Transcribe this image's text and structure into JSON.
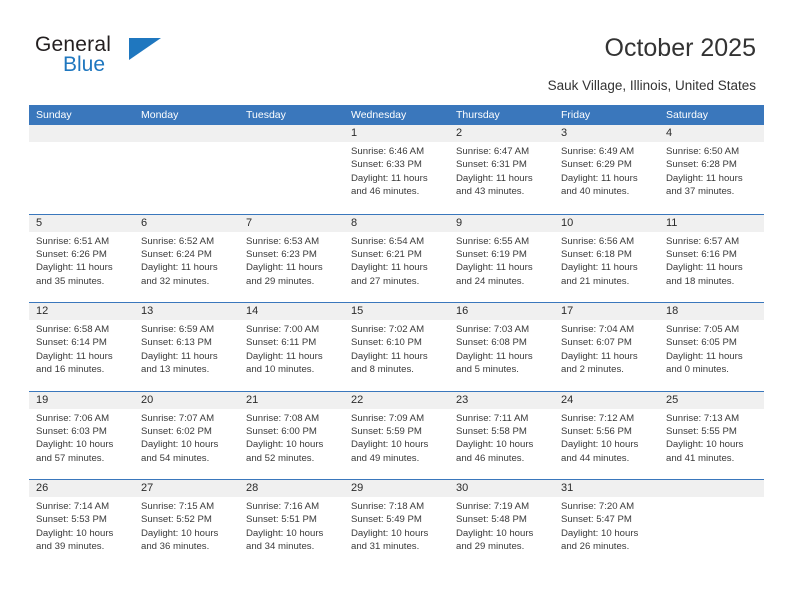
{
  "brand": {
    "name_top": "General",
    "name_bottom": "Blue"
  },
  "header": {
    "title": "October 2025",
    "subtitle": "Sauk Village, Illinois, United States"
  },
  "colors": {
    "header_blue": "#3a77bc",
    "brand_blue": "#1f77bf",
    "daynum_band": "#f0f0f0",
    "text": "#2b2b2b"
  },
  "weekdays": [
    "Sunday",
    "Monday",
    "Tuesday",
    "Wednesday",
    "Thursday",
    "Friday",
    "Saturday"
  ],
  "weeks": [
    [
      {
        "day": "",
        "lines": []
      },
      {
        "day": "",
        "lines": []
      },
      {
        "day": "",
        "lines": []
      },
      {
        "day": "1",
        "lines": [
          "Sunrise: 6:46 AM",
          "Sunset: 6:33 PM",
          "Daylight: 11 hours",
          "and 46 minutes."
        ]
      },
      {
        "day": "2",
        "lines": [
          "Sunrise: 6:47 AM",
          "Sunset: 6:31 PM",
          "Daylight: 11 hours",
          "and 43 minutes."
        ]
      },
      {
        "day": "3",
        "lines": [
          "Sunrise: 6:49 AM",
          "Sunset: 6:29 PM",
          "Daylight: 11 hours",
          "and 40 minutes."
        ]
      },
      {
        "day": "4",
        "lines": [
          "Sunrise: 6:50 AM",
          "Sunset: 6:28 PM",
          "Daylight: 11 hours",
          "and 37 minutes."
        ]
      }
    ],
    [
      {
        "day": "5",
        "lines": [
          "Sunrise: 6:51 AM",
          "Sunset: 6:26 PM",
          "Daylight: 11 hours",
          "and 35 minutes."
        ]
      },
      {
        "day": "6",
        "lines": [
          "Sunrise: 6:52 AM",
          "Sunset: 6:24 PM",
          "Daylight: 11 hours",
          "and 32 minutes."
        ]
      },
      {
        "day": "7",
        "lines": [
          "Sunrise: 6:53 AM",
          "Sunset: 6:23 PM",
          "Daylight: 11 hours",
          "and 29 minutes."
        ]
      },
      {
        "day": "8",
        "lines": [
          "Sunrise: 6:54 AM",
          "Sunset: 6:21 PM",
          "Daylight: 11 hours",
          "and 27 minutes."
        ]
      },
      {
        "day": "9",
        "lines": [
          "Sunrise: 6:55 AM",
          "Sunset: 6:19 PM",
          "Daylight: 11 hours",
          "and 24 minutes."
        ]
      },
      {
        "day": "10",
        "lines": [
          "Sunrise: 6:56 AM",
          "Sunset: 6:18 PM",
          "Daylight: 11 hours",
          "and 21 minutes."
        ]
      },
      {
        "day": "11",
        "lines": [
          "Sunrise: 6:57 AM",
          "Sunset: 6:16 PM",
          "Daylight: 11 hours",
          "and 18 minutes."
        ]
      }
    ],
    [
      {
        "day": "12",
        "lines": [
          "Sunrise: 6:58 AM",
          "Sunset: 6:14 PM",
          "Daylight: 11 hours",
          "and 16 minutes."
        ]
      },
      {
        "day": "13",
        "lines": [
          "Sunrise: 6:59 AM",
          "Sunset: 6:13 PM",
          "Daylight: 11 hours",
          "and 13 minutes."
        ]
      },
      {
        "day": "14",
        "lines": [
          "Sunrise: 7:00 AM",
          "Sunset: 6:11 PM",
          "Daylight: 11 hours",
          "and 10 minutes."
        ]
      },
      {
        "day": "15",
        "lines": [
          "Sunrise: 7:02 AM",
          "Sunset: 6:10 PM",
          "Daylight: 11 hours",
          "and 8 minutes."
        ]
      },
      {
        "day": "16",
        "lines": [
          "Sunrise: 7:03 AM",
          "Sunset: 6:08 PM",
          "Daylight: 11 hours",
          "and 5 minutes."
        ]
      },
      {
        "day": "17",
        "lines": [
          "Sunrise: 7:04 AM",
          "Sunset: 6:07 PM",
          "Daylight: 11 hours",
          "and 2 minutes."
        ]
      },
      {
        "day": "18",
        "lines": [
          "Sunrise: 7:05 AM",
          "Sunset: 6:05 PM",
          "Daylight: 11 hours",
          "and 0 minutes."
        ]
      }
    ],
    [
      {
        "day": "19",
        "lines": [
          "Sunrise: 7:06 AM",
          "Sunset: 6:03 PM",
          "Daylight: 10 hours",
          "and 57 minutes."
        ]
      },
      {
        "day": "20",
        "lines": [
          "Sunrise: 7:07 AM",
          "Sunset: 6:02 PM",
          "Daylight: 10 hours",
          "and 54 minutes."
        ]
      },
      {
        "day": "21",
        "lines": [
          "Sunrise: 7:08 AM",
          "Sunset: 6:00 PM",
          "Daylight: 10 hours",
          "and 52 minutes."
        ]
      },
      {
        "day": "22",
        "lines": [
          "Sunrise: 7:09 AM",
          "Sunset: 5:59 PM",
          "Daylight: 10 hours",
          "and 49 minutes."
        ]
      },
      {
        "day": "23",
        "lines": [
          "Sunrise: 7:11 AM",
          "Sunset: 5:58 PM",
          "Daylight: 10 hours",
          "and 46 minutes."
        ]
      },
      {
        "day": "24",
        "lines": [
          "Sunrise: 7:12 AM",
          "Sunset: 5:56 PM",
          "Daylight: 10 hours",
          "and 44 minutes."
        ]
      },
      {
        "day": "25",
        "lines": [
          "Sunrise: 7:13 AM",
          "Sunset: 5:55 PM",
          "Daylight: 10 hours",
          "and 41 minutes."
        ]
      }
    ],
    [
      {
        "day": "26",
        "lines": [
          "Sunrise: 7:14 AM",
          "Sunset: 5:53 PM",
          "Daylight: 10 hours",
          "and 39 minutes."
        ]
      },
      {
        "day": "27",
        "lines": [
          "Sunrise: 7:15 AM",
          "Sunset: 5:52 PM",
          "Daylight: 10 hours",
          "and 36 minutes."
        ]
      },
      {
        "day": "28",
        "lines": [
          "Sunrise: 7:16 AM",
          "Sunset: 5:51 PM",
          "Daylight: 10 hours",
          "and 34 minutes."
        ]
      },
      {
        "day": "29",
        "lines": [
          "Sunrise: 7:18 AM",
          "Sunset: 5:49 PM",
          "Daylight: 10 hours",
          "and 31 minutes."
        ]
      },
      {
        "day": "30",
        "lines": [
          "Sunrise: 7:19 AM",
          "Sunset: 5:48 PM",
          "Daylight: 10 hours",
          "and 29 minutes."
        ]
      },
      {
        "day": "31",
        "lines": [
          "Sunrise: 7:20 AM",
          "Sunset: 5:47 PM",
          "Daylight: 10 hours",
          "and 26 minutes."
        ]
      },
      {
        "day": "",
        "lines": []
      }
    ]
  ]
}
